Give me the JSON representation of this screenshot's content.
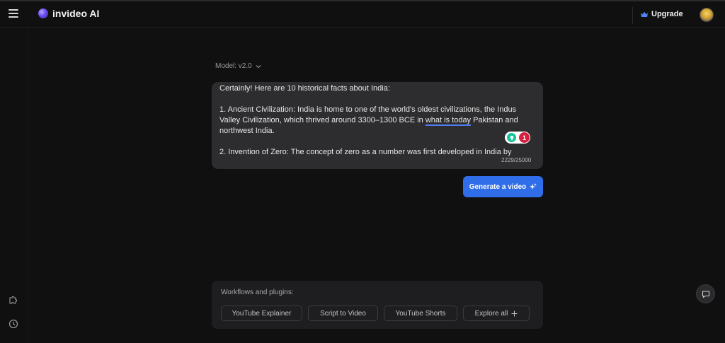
{
  "header": {
    "brand_name": "invideo AI",
    "upgrade_label": "Upgrade",
    "icons": {
      "menu": "hamburger-icon",
      "logo": "invideo-logo-icon",
      "crown": "crown-icon",
      "avatar": "user-avatar"
    }
  },
  "rail": {
    "icons": [
      "puzzle-icon",
      "clock-icon"
    ]
  },
  "model_selector": {
    "label": "Model: v2.0",
    "icon": "chevron-down-icon"
  },
  "prompt": {
    "lines": [
      "Certainly! Here are 10 historical facts about India:",
      "",
      "1. Ancient Civilization: India is home to one of the world's oldest civilizations, the Indus",
      "Valley Civilization, which thrived around 3300–1300 BCE in ",
      "what is today",
      " Pakistan and",
      "northwest India.",
      "",
      "2. Invention of Zero: The concept of zero as a number was first developed in India by"
    ],
    "char_count": "2229/25000",
    "grammarly_count": "1"
  },
  "generate": {
    "label": "Generate a video",
    "icon": "sparkle-icon"
  },
  "workflows": {
    "title": "Workflows and plugins:",
    "buttons": [
      {
        "label": "YouTube Explainer"
      },
      {
        "label": "Script to Video"
      },
      {
        "label": "YouTube Shorts"
      },
      {
        "label": "Explore all",
        "icon": "plus-icon"
      }
    ]
  },
  "chat": {
    "icon": "chat-bubble-icon"
  },
  "colors": {
    "accent": "#2f6ee8",
    "background": "#101011",
    "panel": "#2d2d2f",
    "grammarly_green": "#15c39a",
    "badge_red": "#d6203f"
  }
}
